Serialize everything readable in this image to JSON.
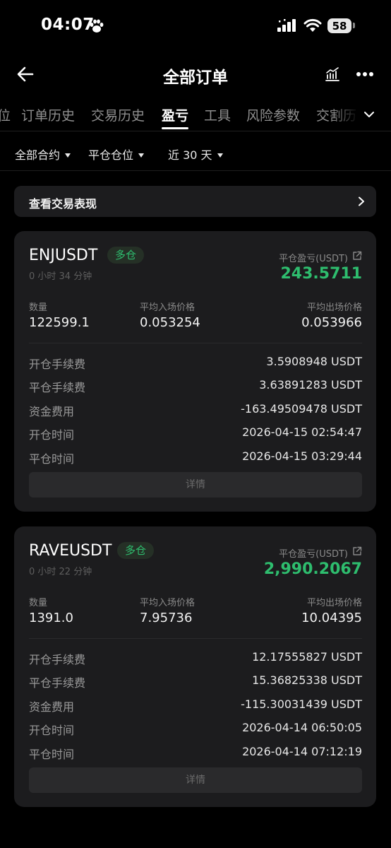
{
  "status_bar": {
    "time": "04:07",
    "battery": "58"
  },
  "header": {
    "title": "全部订单",
    "back_icon": "back-arrow-icon",
    "chart_icon": "chart-icon",
    "more_icon": "more-icon"
  },
  "tabs": [
    {
      "label": "位"
    },
    {
      "label": "订单历史"
    },
    {
      "label": "交易历史"
    },
    {
      "label": "盈亏",
      "active": true
    },
    {
      "label": "工具"
    },
    {
      "label": "风险参数"
    },
    {
      "label": "交割历"
    }
  ],
  "filters": {
    "contract": "全部合约",
    "position": "平仓仓位",
    "period": "近 30 天"
  },
  "performance": {
    "label": "查看交易表现"
  },
  "colors": {
    "profit_green": "#2ebd6e",
    "card_bg": "#1c1c1e",
    "background": "#000000"
  },
  "positions": [
    {
      "symbol": "ENJUSDT",
      "side": "多仓",
      "duration": "0 小时 34 分钟",
      "pnl_label": "平仓盈亏(USDT)",
      "pnl": "243.5711",
      "qty_label": "数量",
      "qty": "122599.1",
      "entry_label": "平均入场价格",
      "entry": "0.053254",
      "exit_label": "平均出场价格",
      "exit": "0.053966",
      "details": [
        {
          "label": "开仓手续费",
          "value": "3.5908948 USDT"
        },
        {
          "label": "平仓手续费",
          "value": "3.63891283 USDT"
        },
        {
          "label": "资金费用",
          "value": "-163.49509478 USDT"
        },
        {
          "label": "开仓时间",
          "value": "2026-04-15 02:54:47"
        },
        {
          "label": "平仓时间",
          "value": "2026-04-15 03:29:44"
        }
      ],
      "details_button": "详情"
    },
    {
      "symbol": "RAVEUSDT",
      "side": "多仓",
      "duration": "0 小时 22 分钟",
      "pnl_label": "平仓盈亏(USDT)",
      "pnl": "2,990.2067",
      "qty_label": "数量",
      "qty": "1391.0",
      "entry_label": "平均入场价格",
      "entry": "7.95736",
      "exit_label": "平均出场价格",
      "exit": "10.04395",
      "details": [
        {
          "label": "开仓手续费",
          "value": "12.17555827 USDT"
        },
        {
          "label": "平仓手续费",
          "value": "15.36825338 USDT"
        },
        {
          "label": "资金费用",
          "value": "-115.30031439 USDT"
        },
        {
          "label": "开仓时间",
          "value": "2026-04-14 06:50:05"
        },
        {
          "label": "平仓时间",
          "value": "2026-04-14 07:12:19"
        }
      ],
      "details_button": "详情"
    }
  ]
}
